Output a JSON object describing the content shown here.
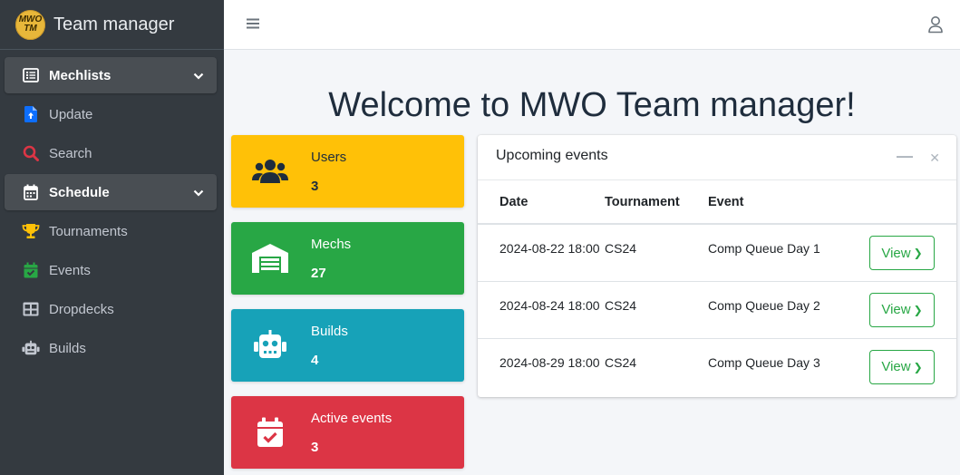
{
  "brand": {
    "logo_line1": "MWO",
    "logo_line2": "TM",
    "title": "Team manager"
  },
  "sidebar": {
    "items": [
      {
        "label": "Mechlists",
        "icon": "list-icon",
        "open": true,
        "caret": "chevron-down-icon"
      },
      {
        "label": "Update",
        "icon": "file-upload-icon",
        "color": "#0d6efd"
      },
      {
        "label": "Search",
        "icon": "search-icon",
        "color": "#dc3545"
      },
      {
        "label": "Schedule",
        "icon": "calendar-icon",
        "open": true,
        "caret": "chevron-down-icon"
      },
      {
        "label": "Tournaments",
        "icon": "trophy-icon",
        "color": "#ffc107"
      },
      {
        "label": "Events",
        "icon": "calendar-check-icon",
        "color": "#28a745"
      },
      {
        "label": "Dropdecks",
        "icon": "table-icon",
        "color": "#c2c7d0"
      },
      {
        "label": "Builds",
        "icon": "robot-icon",
        "color": "#c2c7d0"
      }
    ]
  },
  "topbar": {
    "menu_icon": "hamburger-icon",
    "user_icon": "user-icon"
  },
  "main": {
    "title": "Welcome to MWO Team manager!",
    "info_boxes": [
      {
        "label": "Users",
        "value": "3",
        "icon": "users-icon",
        "color": "#ffc107"
      },
      {
        "label": "Mechs",
        "value": "27",
        "icon": "warehouse-icon",
        "color": "#28a745"
      },
      {
        "label": "Builds",
        "value": "4",
        "icon": "robot-icon",
        "color": "#17a2b8"
      },
      {
        "label": "Active events",
        "value": "3",
        "icon": "calendar-check-icon",
        "color": "#dc3545"
      }
    ],
    "events_card": {
      "title": "Upcoming events",
      "columns": [
        "Date",
        "Tournament",
        "Event"
      ],
      "rows": [
        {
          "date": "2024-08-22 18:00",
          "tournament": "CS24",
          "event": "Comp Queue Day 1",
          "action": "View"
        },
        {
          "date": "2024-08-24 18:00",
          "tournament": "CS24",
          "event": "Comp Queue Day 2",
          "action": "View"
        },
        {
          "date": "2024-08-29 18:00",
          "tournament": "CS24",
          "event": "Comp Queue Day 3",
          "action": "View"
        }
      ]
    }
  }
}
